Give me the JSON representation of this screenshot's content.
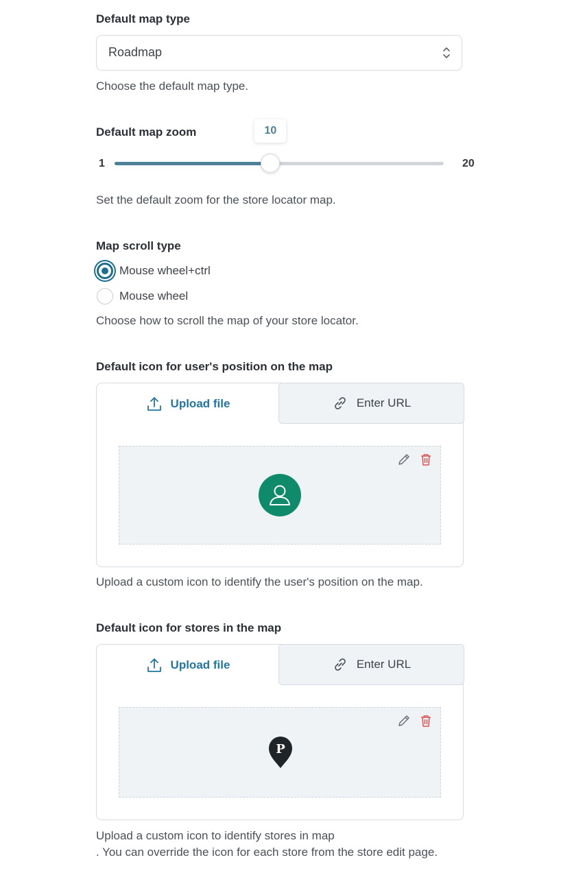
{
  "map_type": {
    "label": "Default map type",
    "selected": "Roadmap",
    "description": "Choose the default map type."
  },
  "zoom": {
    "label": "Default map zoom",
    "min": "1",
    "max": "20",
    "value": "10",
    "value_number": 10,
    "range": [
      1,
      20
    ],
    "description": "Set the default zoom for the store locator map.",
    "accent_color": "#4c8197"
  },
  "scroll": {
    "label": "Map scroll type",
    "options": [
      {
        "label": "Mouse wheel+ctrl",
        "selected": true
      },
      {
        "label": "Mouse wheel",
        "selected": false
      }
    ],
    "description": "Choose how to scroll the map of your store locator."
  },
  "user_icon": {
    "label": "Default icon for user's position on the map",
    "upload_label": "Upload file",
    "url_label": "Enter URL",
    "preview_icon": "user-avatar-icon",
    "preview_color": "#0f8a6b",
    "description": "Upload a custom icon to identify the user's position on the map."
  },
  "store_icon": {
    "label": "Default icon for stores in the map",
    "upload_label": "Upload file",
    "url_label": "Enter URL",
    "preview_icon": "map-pin-icon",
    "pin_letter": "P",
    "description_line1": "Upload a custom icon to identify stores in map",
    "description_line2": ". You can override the icon for each store from the store edit page."
  },
  "colors": {
    "link": "#2176a3",
    "radio_active": "#1c6e90",
    "delete": "#d9534f"
  }
}
